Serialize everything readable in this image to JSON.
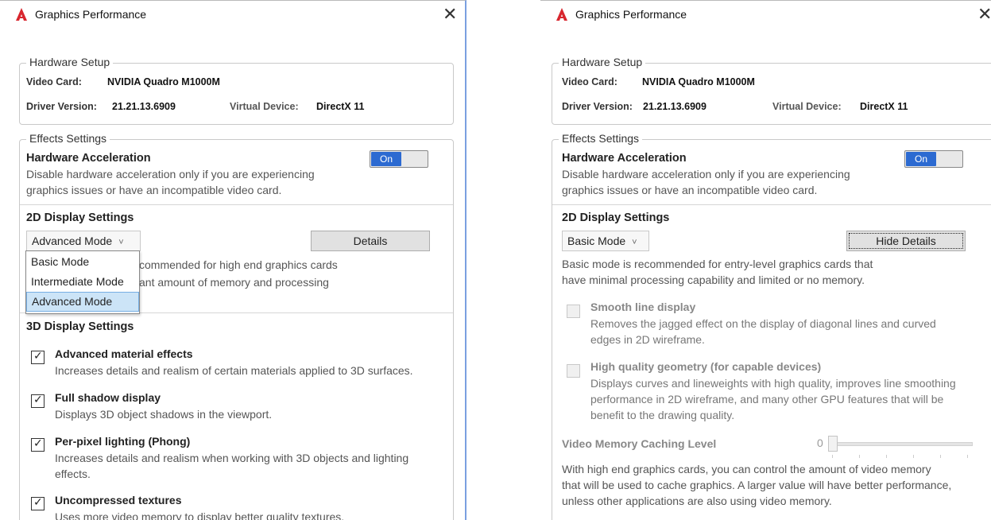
{
  "left": {
    "title": "Graphics Performance",
    "close": "✕",
    "hardware": {
      "legend": "Hardware Setup",
      "video_card_label": "Video Card:",
      "video_card_value": "NVIDIA Quadro M1000M",
      "driver_label": "Driver Version:",
      "driver_value": "21.21.13.6909",
      "virtual_label": "Virtual Device:",
      "virtual_value": "DirectX 11"
    },
    "effects": {
      "legend": "Effects Settings",
      "hw_accel_title": "Hardware Acceleration",
      "hw_accel_desc1": "Disable hardware acceleration only if you are experiencing",
      "hw_accel_desc2": "graphics issues or have an incompatible video card.",
      "toggle_label": "On",
      "display2d_title": "2D Display Settings",
      "mode_selected": "Advanced Mode",
      "details_button": "Details",
      "partial_desc1": "commended for high end graphics cards",
      "partial_desc2": "ant amount of memory and processing",
      "dropdown_options": [
        "Basic Mode",
        "Intermediate Mode",
        "Advanced Mode"
      ],
      "display3d_title": "3D Display Settings",
      "options3d": [
        {
          "title": "Advanced material effects",
          "desc": "Increases details and realism of certain materials applied to 3D surfaces.",
          "checked": true
        },
        {
          "title": "Full shadow display",
          "desc": "Displays 3D object shadows in the viewport.",
          "checked": true
        },
        {
          "title": "Per-pixel lighting (Phong)",
          "desc": "Increases details and realism when working with 3D objects and lighting",
          "desc2": "effects.",
          "checked": true
        },
        {
          "title": "Uncompressed textures",
          "desc": "Uses more video memory to display better quality textures.",
          "checked": true
        }
      ]
    }
  },
  "right": {
    "title": "Graphics Performance",
    "close": "✕",
    "hardware": {
      "legend": "Hardware Setup",
      "video_card_label": "Video Card:",
      "video_card_value": "NVIDIA Quadro M1000M",
      "driver_label": "Driver Version:",
      "driver_value": "21.21.13.6909",
      "virtual_label": "Virtual Device:",
      "virtual_value": "DirectX 11"
    },
    "effects": {
      "legend": "Effects Settings",
      "hw_accel_title": "Hardware Acceleration",
      "hw_accel_desc1": "Disable hardware acceleration only if you are experiencing",
      "hw_accel_desc2": "graphics issues or have an incompatible video card.",
      "toggle_label": "On",
      "display2d_title": "2D Display Settings",
      "mode_selected": "Basic Mode",
      "hide_details_button": "Hide Details",
      "basic_desc1": "Basic mode is recommended for entry-level graphics cards that",
      "basic_desc2": "have minimal processing capability and limited or no memory.",
      "smooth_title": "Smooth line display",
      "smooth_desc1": "Removes the jagged effect on the display of diagonal lines and curved",
      "smooth_desc2": "edges in 2D wireframe.",
      "hq_title": "High quality geometry (for capable devices)",
      "hq_desc1": "Displays curves and lineweights with high quality, improves line smoothing",
      "hq_desc2": "performance in 2D wireframe, and many other GPU features that will be",
      "hq_desc3": "benefit to the drawing quality.",
      "vmc_title": "Video Memory Caching Level",
      "vmc_value": "0",
      "vmc_desc1": "With high end graphics cards, you can control the amount of video memory",
      "vmc_desc2": "that will be used to cache graphics.  A larger value will have better performance,",
      "vmc_desc3": "unless other applications are also using video memory."
    }
  },
  "colors": {
    "accent": "#2c6ad1",
    "autocad_red": "#d8262e",
    "selection": "#cce4f7"
  },
  "icons": {
    "app": "autocad-logo-icon",
    "close": "close-icon",
    "chevron": "chevron-down-icon",
    "check": "checkmark-icon"
  }
}
